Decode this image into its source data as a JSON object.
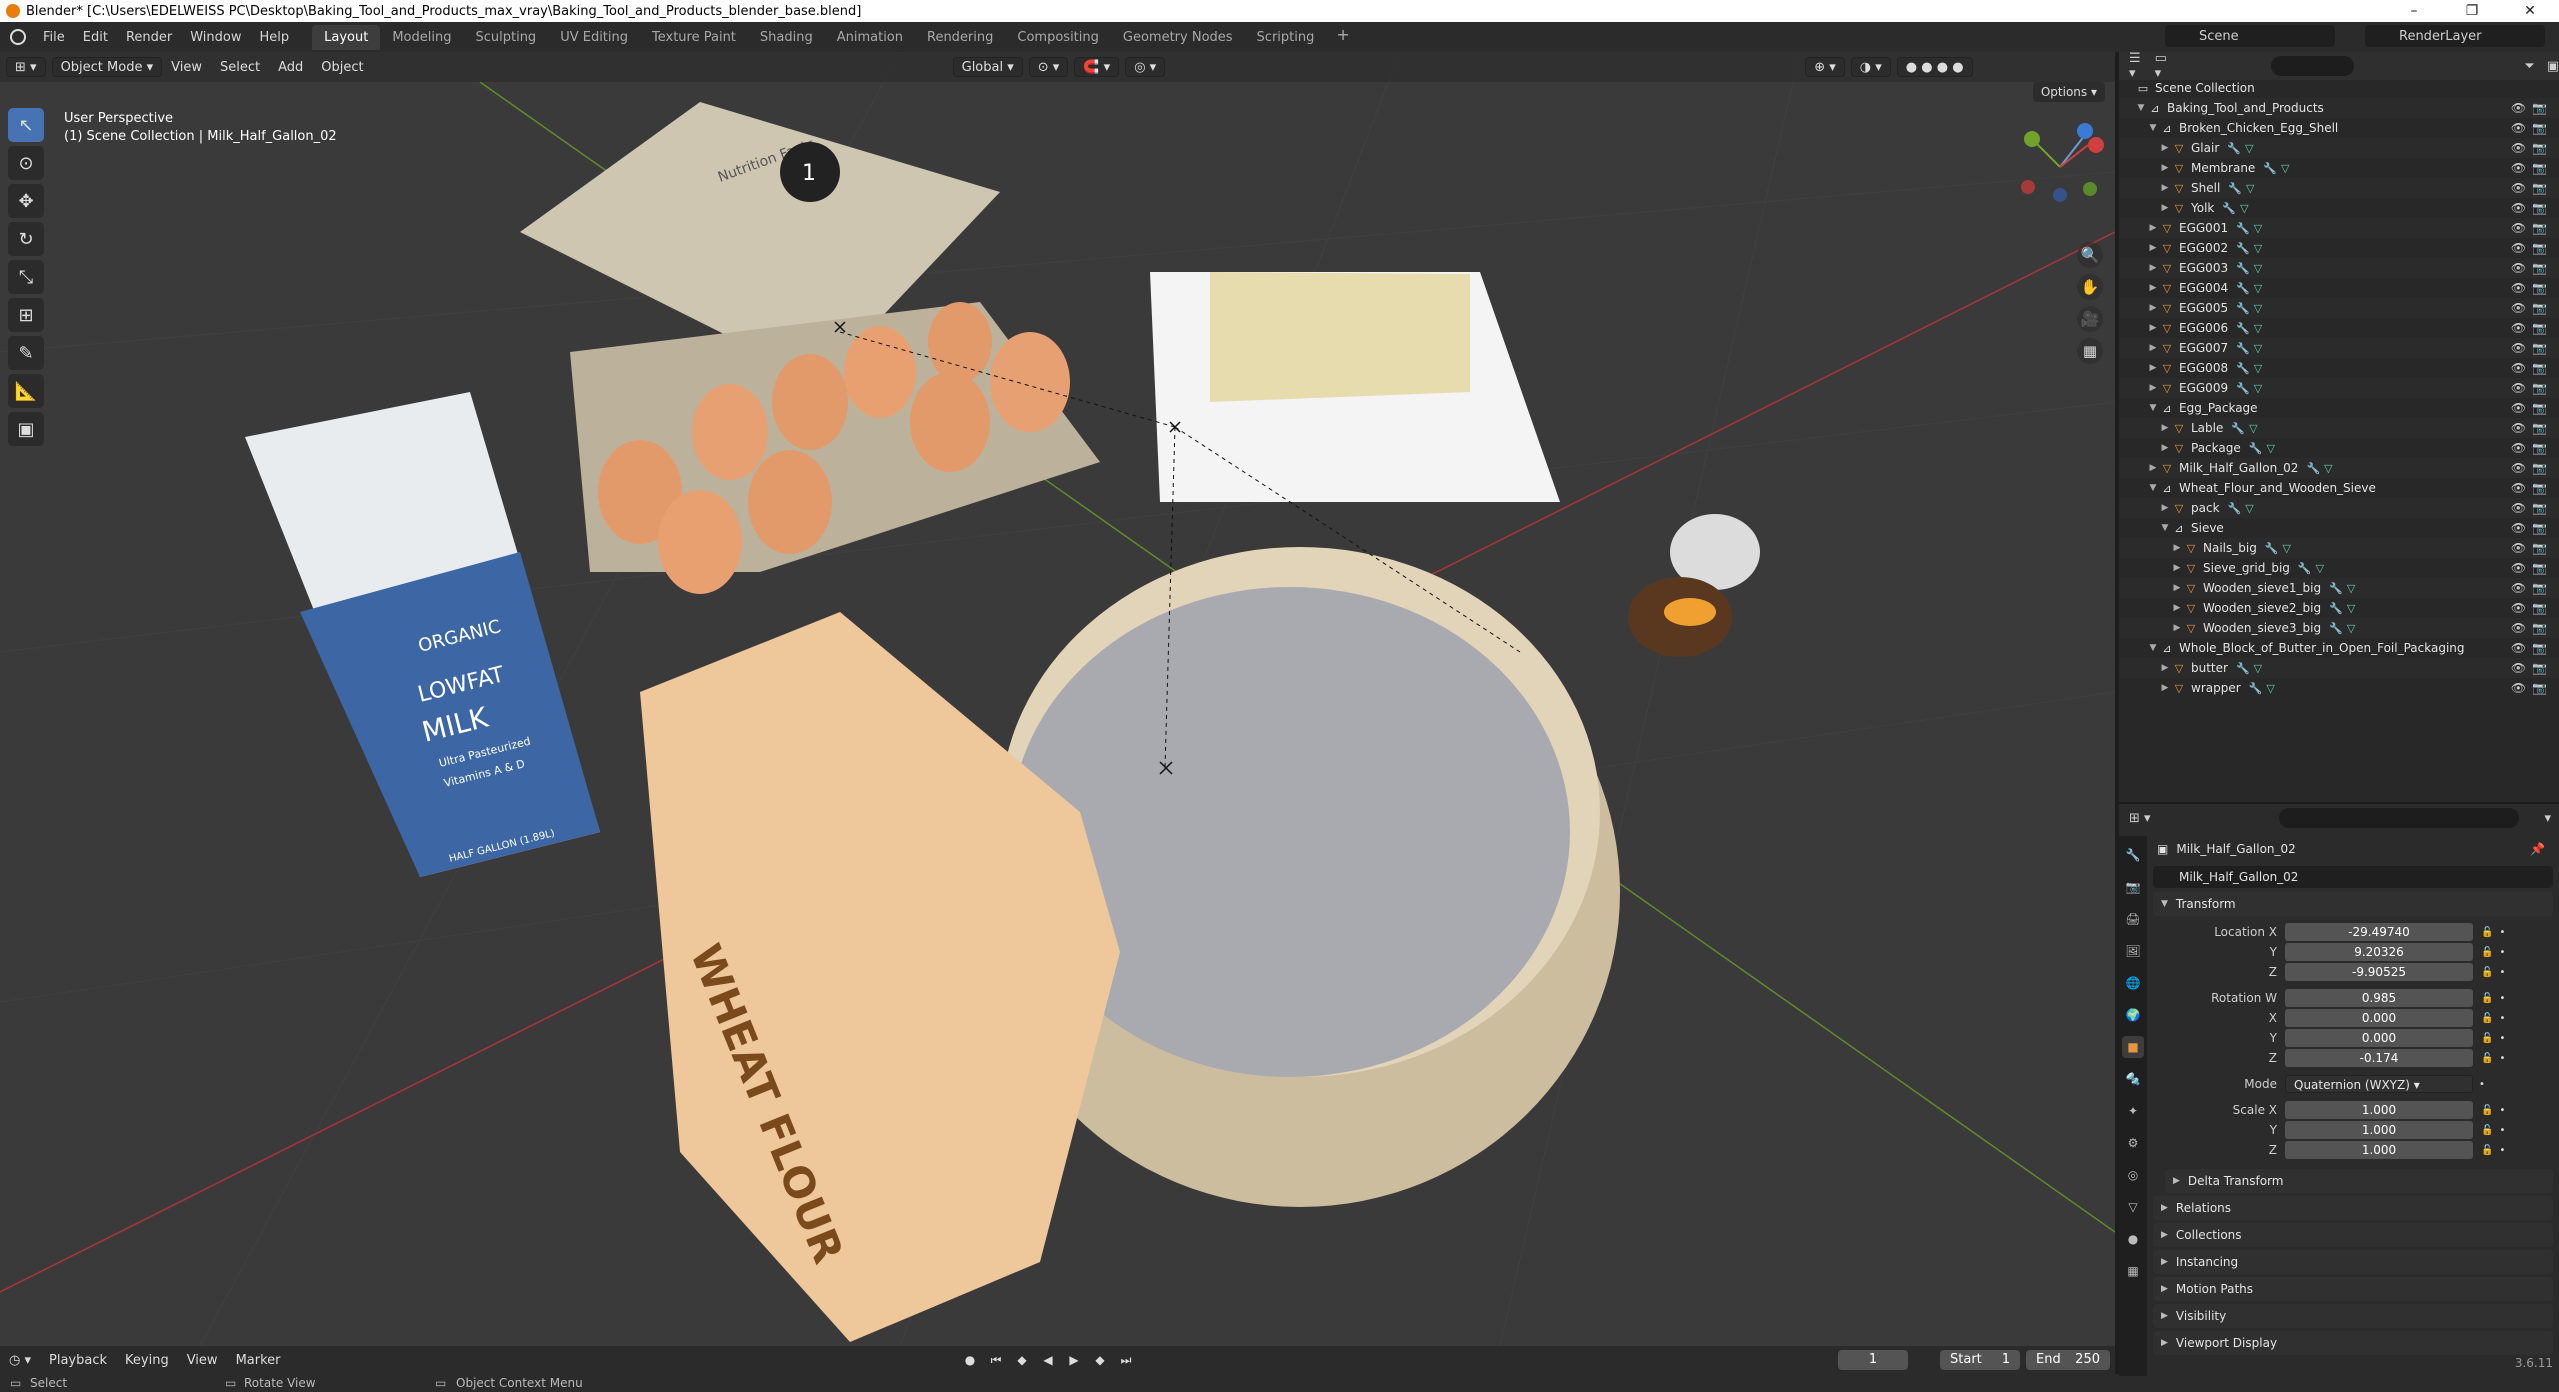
{
  "window": {
    "title": "Blender* [C:\\Users\\EDELWEISS PC\\Desktop\\Baking_Tool_and_Products_max_vray\\Baking_Tool_and_Products_blender_base.blend]",
    "minimize": "–",
    "maximize": "❐",
    "close": "✕"
  },
  "menu": [
    "File",
    "Edit",
    "Render",
    "Window",
    "Help"
  ],
  "workspaces": [
    "Layout",
    "Modeling",
    "Sculpting",
    "UV Editing",
    "Texture Paint",
    "Shading",
    "Animation",
    "Rendering",
    "Compositing",
    "Geometry Nodes",
    "Scripting"
  ],
  "workspace_add": "+",
  "scene": "Scene",
  "render_layer": "RenderLayer",
  "viewport": {
    "mode": "Object Mode",
    "menus": [
      "View",
      "Select",
      "Add",
      "Object"
    ],
    "transform_orientation": "Global",
    "options": "Options",
    "info_line1": "User Perspective",
    "info_line2": "(1) Scene Collection | Milk_Half_Gallon_02",
    "tools": [
      "select-box",
      "cursor",
      "move",
      "rotate",
      "scale",
      "transform",
      "annotate",
      "measure",
      "add-cube"
    ],
    "tool_glyphs": [
      "↖",
      "⊙",
      "✥",
      "↻",
      "⤡",
      "⊞",
      "✎",
      "📐",
      "▣"
    ],
    "nav_glyphs": [
      "🔍",
      "✋",
      "🎥",
      "▦"
    ],
    "scene_labels": {
      "egg_panel": "Nutrition Facts",
      "egg_badge": "1",
      "milk_brand": "ORGANIC",
      "milk_text1": "LOWFAT",
      "milk_text2": "MILK",
      "milk_text3": "Ultra Pasteurized",
      "milk_text4": "Vitamins A & D",
      "milk_text5": "HALF GALLON (1.89L)",
      "flour_text": "WHEAT FLOUR"
    }
  },
  "timeline": {
    "menus": [
      "Playback",
      "Keying",
      "View",
      "Marker"
    ],
    "current_frame": "1",
    "start_label": "Start",
    "start": "1",
    "end_label": "End",
    "end": "250"
  },
  "statusbar": {
    "select": "Select",
    "rotate": "Rotate View",
    "context": "Object Context Menu",
    "version": "3.6.11"
  },
  "outliner": {
    "root": "Scene Collection",
    "rows": [
      {
        "name": "Baking_Tool_and_Products",
        "depth": 0,
        "kind": "coll",
        "expanded": true,
        "mods": false
      },
      {
        "name": "Broken_Chicken_Egg_Shell",
        "depth": 1,
        "kind": "coll",
        "expanded": true,
        "mods": false
      },
      {
        "name": "Glair",
        "depth": 2,
        "kind": "obj",
        "expanded": false,
        "mods": true
      },
      {
        "name": "Membrane",
        "depth": 2,
        "kind": "obj",
        "expanded": false,
        "mods": true
      },
      {
        "name": "Shell",
        "depth": 2,
        "kind": "obj",
        "expanded": false,
        "mods": true
      },
      {
        "name": "Yolk",
        "depth": 2,
        "kind": "obj",
        "expanded": false,
        "mods": true
      },
      {
        "name": "EGG001",
        "depth": 1,
        "kind": "obj",
        "expanded": false,
        "mods": true
      },
      {
        "name": "EGG002",
        "depth": 1,
        "kind": "obj",
        "expanded": false,
        "mods": true
      },
      {
        "name": "EGG003",
        "depth": 1,
        "kind": "obj",
        "expanded": false,
        "mods": true
      },
      {
        "name": "EGG004",
        "depth": 1,
        "kind": "obj",
        "expanded": false,
        "mods": true
      },
      {
        "name": "EGG005",
        "depth": 1,
        "kind": "obj",
        "expanded": false,
        "mods": true
      },
      {
        "name": "EGG006",
        "depth": 1,
        "kind": "obj",
        "expanded": false,
        "mods": true
      },
      {
        "name": "EGG007",
        "depth": 1,
        "kind": "obj",
        "expanded": false,
        "mods": true
      },
      {
        "name": "EGG008",
        "depth": 1,
        "kind": "obj",
        "expanded": false,
        "mods": true
      },
      {
        "name": "EGG009",
        "depth": 1,
        "kind": "obj",
        "expanded": false,
        "mods": true
      },
      {
        "name": "Egg_Package",
        "depth": 1,
        "kind": "coll",
        "expanded": true,
        "mods": false
      },
      {
        "name": "Lable",
        "depth": 2,
        "kind": "obj",
        "expanded": false,
        "mods": true
      },
      {
        "name": "Package",
        "depth": 2,
        "kind": "obj",
        "expanded": false,
        "mods": true
      },
      {
        "name": "Milk_Half_Gallon_02",
        "depth": 1,
        "kind": "obj",
        "expanded": false,
        "mods": true
      },
      {
        "name": "Wheat_Flour_and_Wooden_Sieve",
        "depth": 1,
        "kind": "coll",
        "expanded": true,
        "mods": false
      },
      {
        "name": "pack",
        "depth": 2,
        "kind": "obj",
        "expanded": false,
        "mods": true
      },
      {
        "name": "Sieve",
        "depth": 2,
        "kind": "coll",
        "expanded": true,
        "mods": false
      },
      {
        "name": "Nails_big",
        "depth": 3,
        "kind": "obj",
        "expanded": false,
        "mods": true
      },
      {
        "name": "Sieve_grid_big",
        "depth": 3,
        "kind": "obj",
        "expanded": false,
        "mods": true
      },
      {
        "name": "Wooden_sieve1_big",
        "depth": 3,
        "kind": "obj",
        "expanded": false,
        "mods": true
      },
      {
        "name": "Wooden_sieve2_big",
        "depth": 3,
        "kind": "obj",
        "expanded": false,
        "mods": true
      },
      {
        "name": "Wooden_sieve3_big",
        "depth": 3,
        "kind": "obj",
        "expanded": false,
        "mods": true
      },
      {
        "name": "Whole_Block_of_Butter_in_Open_Foil_Packaging",
        "depth": 1,
        "kind": "coll",
        "expanded": true,
        "mods": false
      },
      {
        "name": "butter",
        "depth": 2,
        "kind": "obj",
        "expanded": false,
        "mods": true
      },
      {
        "name": "wrapper",
        "depth": 2,
        "kind": "obj",
        "expanded": false,
        "mods": true
      }
    ]
  },
  "properties": {
    "object_name": "Milk_Half_Gallon_02",
    "object_field": "Milk_Half_Gallon_02",
    "transform_label": "Transform",
    "location_label": "Location X",
    "location": [
      "-29.49740",
      "9.20326",
      "-9.90525"
    ],
    "rotation_label": "Rotation W",
    "rotation": [
      "0.985",
      "0.000",
      "0.000",
      "-0.174"
    ],
    "mode_label": "Mode",
    "mode": "Quaternion (WXYZ)",
    "scale_label": "Scale X",
    "scale": [
      "1.000",
      "1.000",
      "1.000"
    ],
    "axis_y": "Y",
    "axis_z": "Z",
    "axis_x": "X",
    "delta": "Delta Transform",
    "panels": [
      "Relations",
      "Collections",
      "Instancing",
      "Motion Paths",
      "Visibility",
      "Viewport Display"
    ],
    "tab_glyphs": [
      "🔧",
      "📷",
      "🖨",
      "🖼",
      "🌐",
      "🌍",
      "■",
      "🔩",
      "✦",
      "⚙",
      "◎",
      "▽",
      "●",
      "▦"
    ]
  },
  "colors": {
    "accent": "#4772b3",
    "object_orange": "#e8963c",
    "viewport_bg": "#3a3a3a",
    "axis_x": "#d23f3f",
    "axis_y": "#6fa32a"
  }
}
